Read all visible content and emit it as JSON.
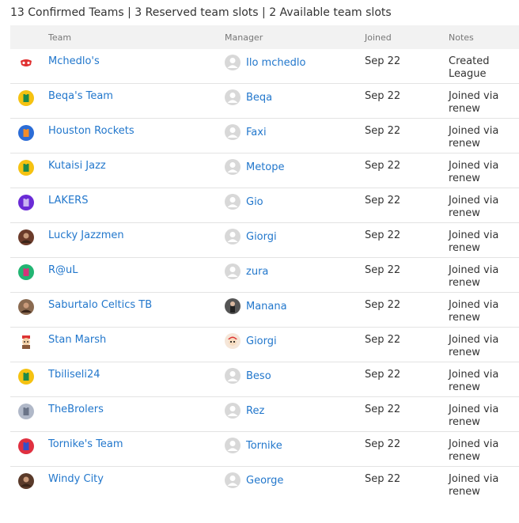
{
  "summary": "13 Confirmed Teams | 3 Reserved team slots | 2 Available team slots",
  "headers": {
    "team": "Team",
    "manager": "Manager",
    "joined": "Joined",
    "notes": "Notes"
  },
  "rows": [
    {
      "team": "Mchedlo's",
      "manager": "Ilo mchedlo",
      "joined": "Sep 22",
      "notes": "Created League",
      "icon": "red-mask-icon",
      "color": "#e03030",
      "avatar": "default"
    },
    {
      "team": "Beqa's Team",
      "manager": "Beqa",
      "joined": "Sep 22",
      "notes": "Joined via renew",
      "icon": "green-jersey-icon",
      "color": "#f5c211",
      "avatar": "default"
    },
    {
      "team": "Houston Rockets",
      "manager": "Faxi",
      "joined": "Sep 22",
      "notes": "Joined via renew",
      "icon": "orange-jersey-icon",
      "color": "#2b6cd6",
      "avatar": "default"
    },
    {
      "team": "Kutaisi Jazz",
      "manager": "Metope",
      "joined": "Sep 22",
      "notes": "Joined via renew",
      "icon": "green-jersey-icon",
      "color": "#f5c211",
      "avatar": "default"
    },
    {
      "team": "LAKERS",
      "manager": "Gio",
      "joined": "Sep 22",
      "notes": "Joined via renew",
      "icon": "purple-jersey-icon",
      "color": "#6a2bd6",
      "avatar": "default"
    },
    {
      "team": "Lucky Jazzmen",
      "manager": "Giorgi",
      "joined": "Sep 22",
      "notes": "Joined via renew",
      "icon": "photo-icon",
      "color": "#6b3b2a",
      "avatar": "default"
    },
    {
      "team": "R@uL",
      "manager": "zura",
      "joined": "Sep 22",
      "notes": "Joined via renew",
      "icon": "pink-jersey-icon",
      "color": "#22b573",
      "avatar": "default"
    },
    {
      "team": "Saburtalo Celtics TB",
      "manager": "Manana",
      "joined": "Sep 22",
      "notes": "Joined via renew",
      "icon": "photo-icon",
      "color": "#8a6a50",
      "avatar": "photo"
    },
    {
      "team": "Stan Marsh",
      "manager": "Giorgi",
      "joined": "Sep 22",
      "notes": "Joined via renew",
      "icon": "cartoon-icon",
      "color": "#e8c9a0",
      "avatar": "cartoon"
    },
    {
      "team": "Tbiliseli24",
      "manager": "Beso",
      "joined": "Sep 22",
      "notes": "Joined via renew",
      "icon": "green-jersey-icon",
      "color": "#f5c211",
      "avatar": "default"
    },
    {
      "team": "TheBrolers",
      "manager": "Rez",
      "joined": "Sep 22",
      "notes": "Joined via renew",
      "icon": "grey-jersey-icon",
      "color": "#b0b8c8",
      "avatar": "default"
    },
    {
      "team": "Tornike's Team",
      "manager": "Tornike",
      "joined": "Sep 22",
      "notes": "Joined via renew",
      "icon": "blue-jersey-icon",
      "color": "#e03040",
      "avatar": "default"
    },
    {
      "team": "Windy City",
      "manager": "George",
      "joined": "Sep 22",
      "notes": "Joined via renew",
      "icon": "photo-icon",
      "color": "#5a3a2a",
      "avatar": "default"
    }
  ]
}
